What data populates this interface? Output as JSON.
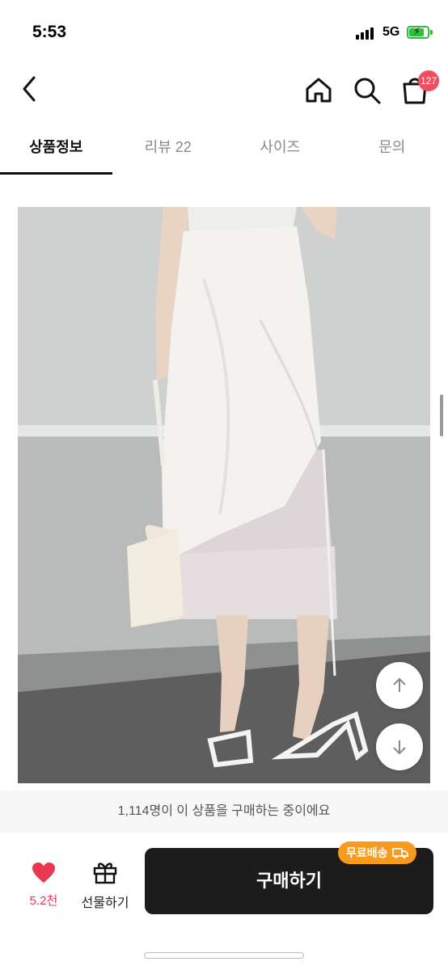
{
  "status_bar": {
    "time": "5:53",
    "network": "5G"
  },
  "header": {
    "cart_count": "127"
  },
  "tabs": [
    {
      "label": "상품정보",
      "active": true
    },
    {
      "label": "리뷰 22",
      "active": false
    },
    {
      "label": "사이즈",
      "active": false
    },
    {
      "label": "문의",
      "active": false
    }
  ],
  "notice": "1,114명이 이 상품을 구매하는 중이에요",
  "actions": {
    "like_count": "5.2천",
    "gift_label": "선물하기",
    "buy_label": "구매하기",
    "free_shipping_badge": "무료배송"
  },
  "colors": {
    "accent_like": "#e8384f",
    "badge": "#f04d5f",
    "shipping": "#f79a1e",
    "buy_button": "#1c1c1c"
  },
  "icons": [
    "back-icon",
    "home-icon",
    "search-icon",
    "cart-icon",
    "arrow-up-icon",
    "arrow-down-icon",
    "heart-icon",
    "gift-icon",
    "truck-icon"
  ]
}
